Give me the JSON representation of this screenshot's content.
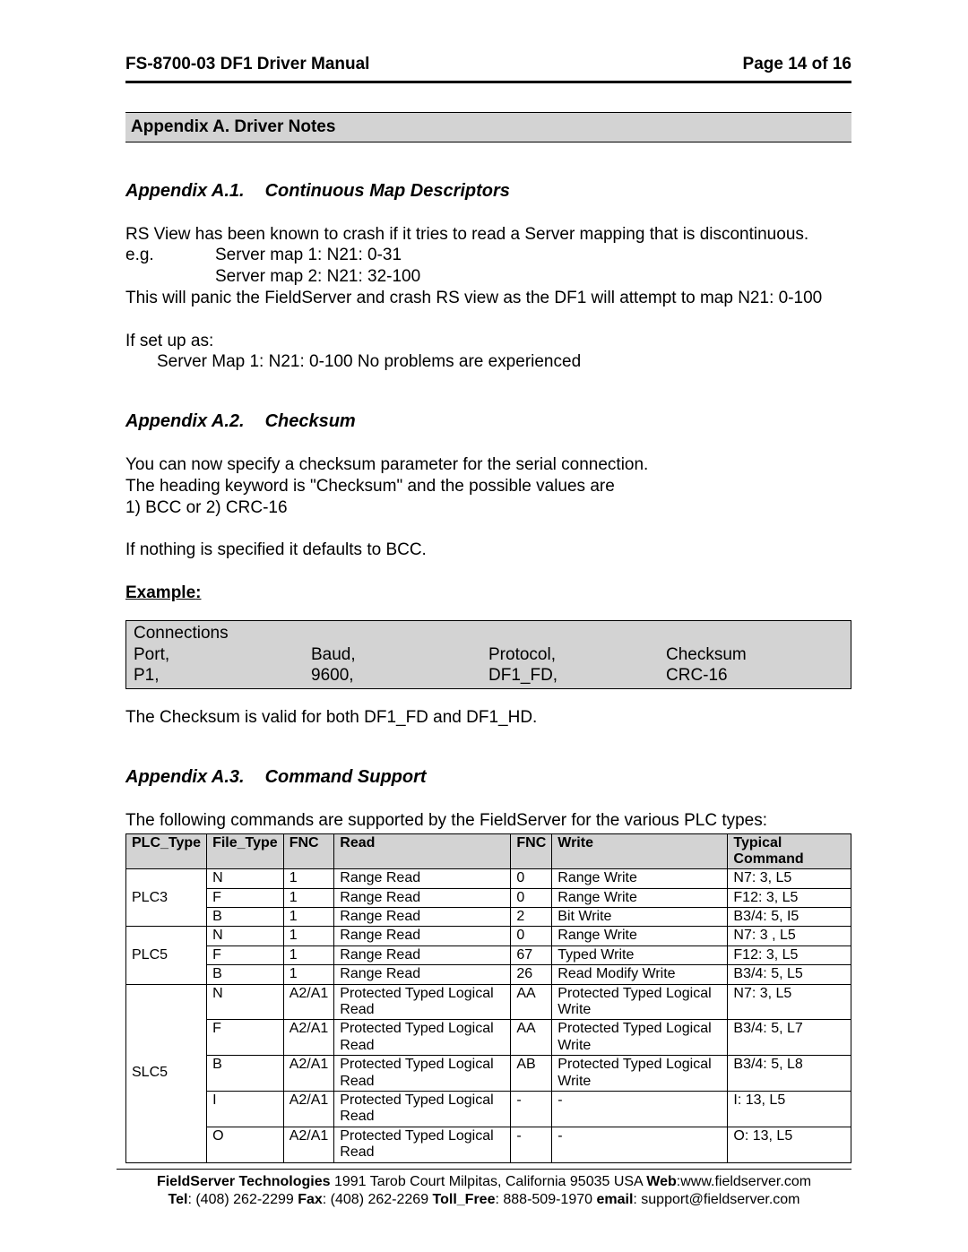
{
  "header": {
    "left": "FS-8700-03 DF1 Driver Manual",
    "right": "Page 14 of 16"
  },
  "sectionBar": "Appendix A. Driver Notes",
  "a1": {
    "num": "Appendix A.1.",
    "title": "Continuous Map Descriptors",
    "p1": "RS View has been known to crash if it tries to read a Server mapping that is discontinuous.",
    "eg_label": "e.g.",
    "eg1": "Server map 1:  N21: 0-31",
    "eg2": "Server map 2:  N21: 32-100",
    "p2": "This will panic the FieldServer and crash RS view as the DF1 will attempt to map N21: 0-100",
    "p3": "If set up as:",
    "p3b": "Server Map 1: N21: 0-100 No problems are experienced"
  },
  "a2": {
    "num": "Appendix A.2.",
    "title": "Checksum",
    "p1": "You can now specify a checksum parameter for the serial connection.",
    "p2": "The heading keyword is \"Checksum\" and the possible values are",
    "p3": "1) BCC or 2) CRC-16",
    "p4": "If nothing is specified it defaults to BCC.",
    "example_label": "Example",
    "conn_title": "Connections",
    "h_port": "Port,",
    "h_baud": "Baud,",
    "h_proto": "Protocol,",
    "h_chk": "Checksum",
    "v_port": "P1,",
    "v_baud": "9600,",
    "v_proto": "DF1_FD,",
    "v_chk": "CRC-16",
    "note": "The Checksum is valid for both DF1_FD and DF1_HD."
  },
  "a3": {
    "num": "Appendix A.3.",
    "title": "Command Support",
    "intro": "The following commands are supported by the FieldServer for the various PLC types:",
    "cols": {
      "c1": "PLC_Type",
      "c2": "File_Type",
      "c3": "FNC",
      "c4": "Read",
      "c5": "FNC",
      "c6": "Write",
      "c7": "Typical Command"
    },
    "rows": [
      {
        "g": "PLC3",
        "pos": "top",
        "plc": "",
        "ft": "N",
        "f1": "1",
        "rd": "Range Read",
        "f2": "0",
        "wr": "Range Write",
        "tc": "N7: 3, L5"
      },
      {
        "g": "PLC3",
        "pos": "mid",
        "plc": "PLC3",
        "ft": "F",
        "f1": "1",
        "rd": "Range Read",
        "f2": "0",
        "wr": "Range Write",
        "tc": "F12: 3, L5"
      },
      {
        "g": "PLC3",
        "pos": "bot",
        "plc": "",
        "ft": "B",
        "f1": "1",
        "rd": "Range Read",
        "f2": "2",
        "wr": "Bit Write",
        "tc": "B3/4: 5, I5"
      },
      {
        "g": "PLC5",
        "pos": "top",
        "plc": "",
        "ft": "N",
        "f1": "1",
        "rd": "Range Read",
        "f2": "0",
        "wr": "Range Write",
        "tc": "N7: 3 , L5"
      },
      {
        "g": "PLC5",
        "pos": "mid",
        "plc": "PLC5",
        "ft": "F",
        "f1": "1",
        "rd": "Range Read",
        "f2": "67",
        "wr": "Typed Write",
        "tc": "F12: 3, L5"
      },
      {
        "g": "PLC5",
        "pos": "bot",
        "plc": "",
        "ft": "B",
        "f1": "1",
        "rd": "Range Read",
        "f2": "26",
        "wr": "Read Modify Write",
        "tc": "B3/4: 5, L5"
      },
      {
        "g": "SLC5",
        "pos": "top",
        "plc": "",
        "ft": "N",
        "f1": "A2/A1",
        "rd": "Protected Typed Logical Read",
        "f2": "AA",
        "wr": "Protected Typed Logical Write",
        "tc": "N7: 3, L5"
      },
      {
        "g": "SLC5",
        "pos": "mid",
        "plc": "",
        "ft": "F",
        "f1": "A2/A1",
        "rd": "Protected Typed Logical Read",
        "f2": "AA",
        "wr": "Protected Typed Logical Write",
        "tc": "B3/4: 5, L7"
      },
      {
        "g": "SLC5",
        "pos": "mid",
        "plc": "SLC5",
        "ft": "B",
        "f1": "A2/A1",
        "rd": "Protected Typed Logical Read",
        "f2": "AB",
        "wr": "Protected Typed Logical Write",
        "tc": "B3/4: 5, L8"
      },
      {
        "g": "SLC5",
        "pos": "mid",
        "plc": "",
        "ft": "I",
        "f1": "A2/A1",
        "rd": "Protected Typed Logical Read",
        "f2": "-",
        "wr": "-",
        "tc": "I: 13, L5"
      },
      {
        "g": "SLC5",
        "pos": "bot",
        "plc": "",
        "ft": "O",
        "f1": "A2/A1",
        "rd": "Protected Typed Logical Read",
        "f2": "-",
        "wr": "-",
        "tc": "O: 13, L5"
      }
    ]
  },
  "footer": {
    "company": "FieldServer Technologies",
    "addr": " 1991 Tarob Court Milpitas, California 95035 USA  ",
    "web_l": "Web",
    "web_v": ":www.fieldserver.com",
    "tel_l": "Tel",
    "tel_v": ": (408) 262-2299   ",
    "fax_l": "Fax",
    "fax_v": ": (408) 262-2269   ",
    "tf_l": "Toll_Free",
    "tf_v": ": 888-509-1970   ",
    "em_l": "email",
    "em_v": ": support@fieldserver.com"
  }
}
